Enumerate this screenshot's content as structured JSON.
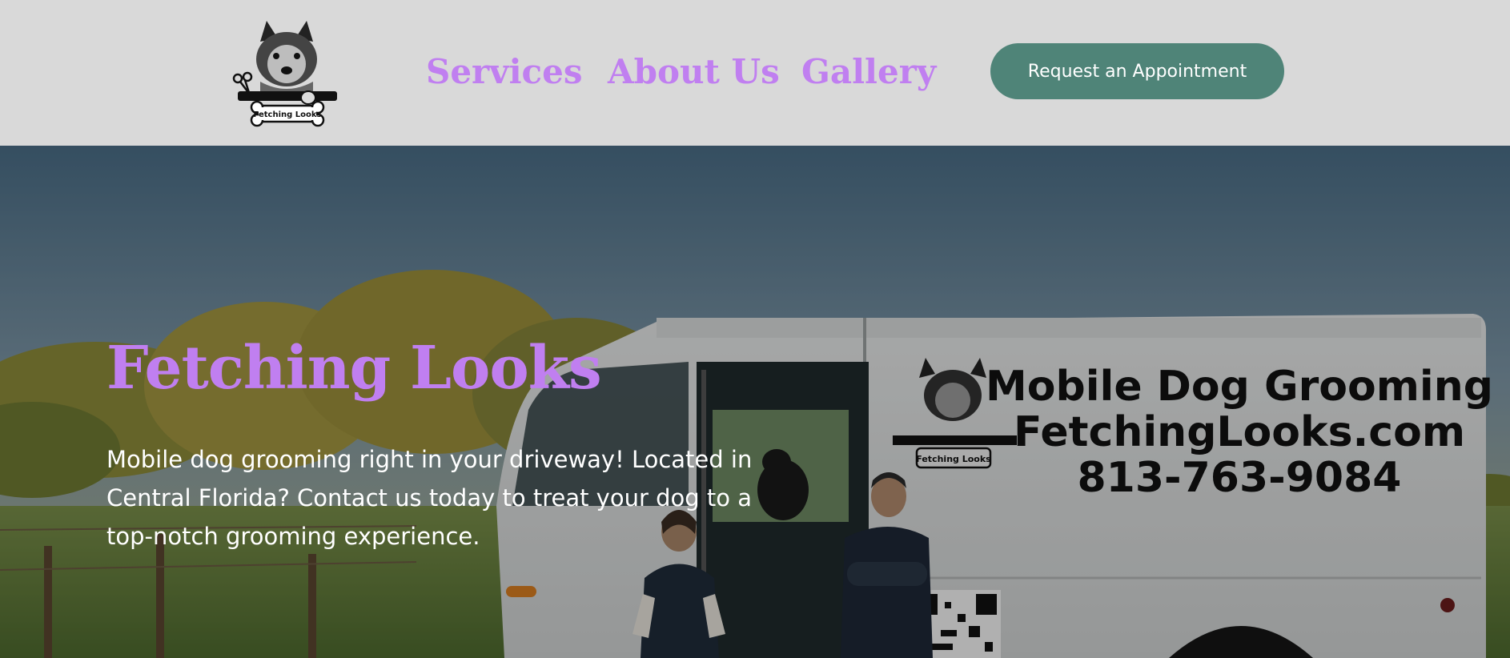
{
  "header": {
    "logo_text": "Fetching Looks",
    "nav": [
      {
        "label": "Services"
      },
      {
        "label": "About Us"
      },
      {
        "label": "Gallery"
      }
    ],
    "cta_label": "Request an Appointment"
  },
  "hero": {
    "title": "Fetching Looks",
    "description": "Mobile dog grooming right in your driveway! Located in Central Florida? Contact us today to treat your dog to a top-notch grooming experience.",
    "van": {
      "line1": "Mobile Dog Grooming",
      "line2": "FetchingLooks.com",
      "line3": "813-763-9084",
      "logo_text": "Fetching Looks"
    }
  },
  "colors": {
    "accent": "#c07ff0",
    "button": "#4f8478",
    "header_bg": "#d9d9d9"
  }
}
